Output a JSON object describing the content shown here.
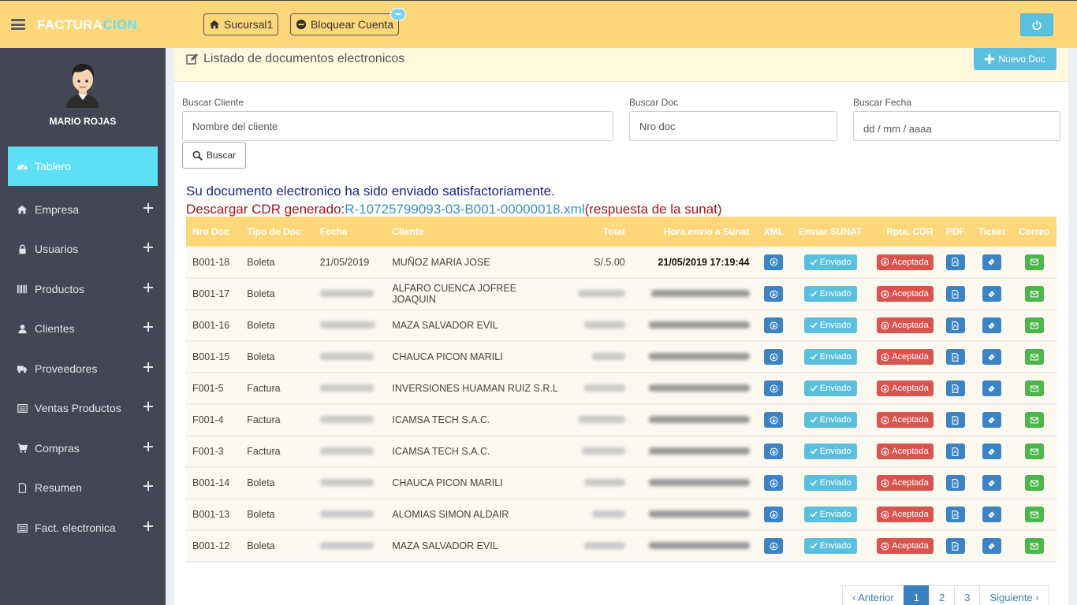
{
  "topbar": {
    "brand_part1": "FACTURA",
    "brand_part2": "CION",
    "sucursal_label": "Sucursal1",
    "bloquear_label": "Bloquear Cuenta"
  },
  "sidebar": {
    "user_name": "MARIO ROJAS",
    "items": [
      {
        "label": "Tablero",
        "icon": "dashboard-icon"
      },
      {
        "label": "Empresa",
        "icon": "home-icon"
      },
      {
        "label": "Usuarios",
        "icon": "lock-icon"
      },
      {
        "label": "Productos",
        "icon": "barcode-icon"
      },
      {
        "label": "Clientes",
        "icon": "user-icon"
      },
      {
        "label": "Proveedores",
        "icon": "truck-icon"
      },
      {
        "label": "Ventas Productos",
        "icon": "list-icon"
      },
      {
        "label": "Compras",
        "icon": "cart-icon"
      },
      {
        "label": "Resumen",
        "icon": "file-icon"
      },
      {
        "label": "Fact. electronica",
        "icon": "list-icon"
      }
    ]
  },
  "panel": {
    "title": "Listado de documentos electronicos",
    "nuevo_label": "Nuevo Doc"
  },
  "filters": {
    "cliente_label": "Buscar Cliente",
    "cliente_placeholder": "Nombre del cliente",
    "doc_label": "Buscar Doc",
    "doc_placeholder": "Nro doc",
    "fecha_label": "Buscar Fecha",
    "fecha_placeholder": "dd / mm / aaaa",
    "buscar_label": "Buscar"
  },
  "messages": {
    "success": "Su documento electronico ha sido enviado satisfactoriamente.",
    "cdr_prefix": "Descargar CDR generado:",
    "cdr_link": "R-10725799093-03-B001-00000018.xml",
    "cdr_suffix": "(respuesta de la sunat)"
  },
  "table": {
    "headers": [
      "Nro Doc",
      "Tipo de Doc",
      "Fecha",
      "Cliente",
      "Total",
      "Hora envio a Sunat",
      "XML",
      "Enviar SUNAT",
      "Rpta. CDR",
      "PDF",
      "Ticket",
      "Correo"
    ],
    "enviado_label": "Enviado",
    "aceptada_label": "Aceptada",
    "rows": [
      {
        "nro": "B001-18",
        "tipo": "Boleta",
        "fecha": "21/05/2019",
        "cliente": "MUÑOZ MARIA JOSE",
        "total": "S/.5.00",
        "hora": "21/05/2019  17:19:44"
      },
      {
        "nro": "B001-17",
        "tipo": "Boleta",
        "fecha": "",
        "cliente": "ALFARO CUENCA JOFREE JOAQUIN",
        "total": "",
        "hora": ""
      },
      {
        "nro": "B001-16",
        "tipo": "Boleta",
        "fecha": "",
        "cliente": "MAZA SALVADOR EVIL",
        "total": "",
        "hora": ""
      },
      {
        "nro": "B001-15",
        "tipo": "Boleta",
        "fecha": "",
        "cliente": "CHAUCA PICON MARILI",
        "total": "",
        "hora": ""
      },
      {
        "nro": "F001-5",
        "tipo": "Factura",
        "fecha": "",
        "cliente": "INVERSIONES HUAMAN RUIZ S.R.L",
        "total": "",
        "hora": ""
      },
      {
        "nro": "F001-4",
        "tipo": "Factura",
        "fecha": "",
        "cliente": "ICAMSA TECH S.A.C.",
        "total": "",
        "hora": ""
      },
      {
        "nro": "F001-3",
        "tipo": "Factura",
        "fecha": "",
        "cliente": "ICAMSA TECH S.A.C.",
        "total": "",
        "hora": ""
      },
      {
        "nro": "B001-14",
        "tipo": "Boleta",
        "fecha": "",
        "cliente": "CHAUCA PICON MARILI",
        "total": "",
        "hora": ""
      },
      {
        "nro": "B001-13",
        "tipo": "Boleta",
        "fecha": "",
        "cliente": "ALOMIAS SIMON ALDAIR",
        "total": "",
        "hora": ""
      },
      {
        "nro": "B001-12",
        "tipo": "Boleta",
        "fecha": "",
        "cliente": "MAZA SALVADOR EVIL",
        "total": "",
        "hora": ""
      }
    ]
  },
  "pagination": {
    "prev": "‹ Anterior",
    "pages": [
      "1",
      "2",
      "3"
    ],
    "current": "1",
    "next": "Siguiente ›"
  }
}
